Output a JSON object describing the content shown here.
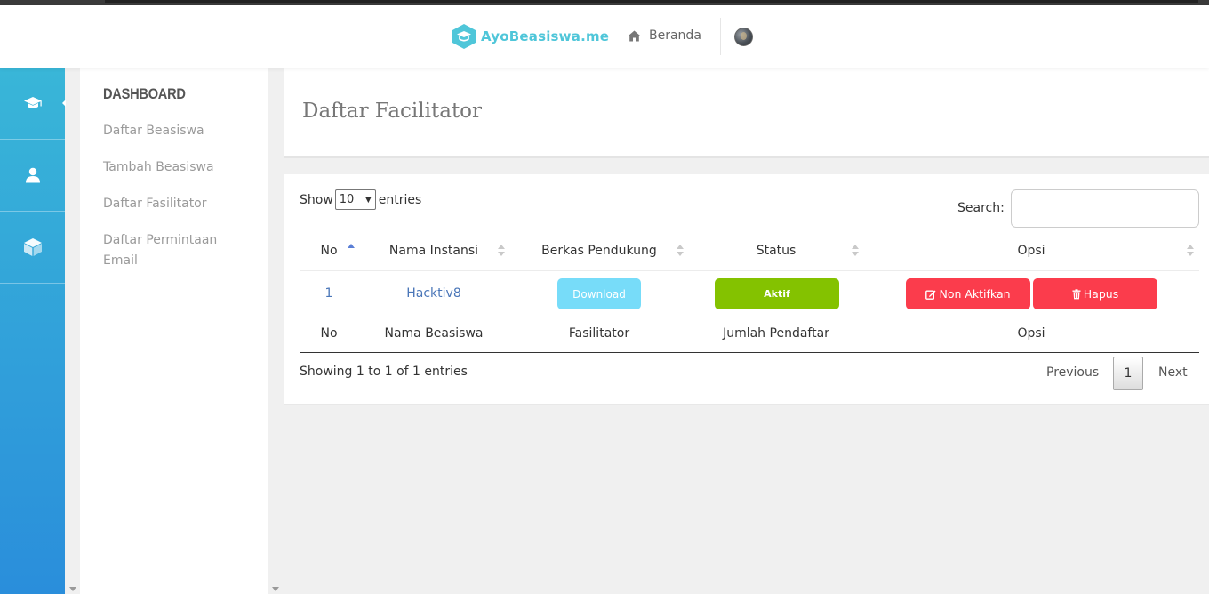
{
  "brand": {
    "name": "AyoBeasiswa.me",
    "color": "#4fc6d9"
  },
  "topnav": {
    "home_label": "Beranda",
    "home_icon": "home-icon",
    "avatar": "user-avatar"
  },
  "iconbar": {
    "items": [
      "graduation-cap-icon",
      "user-icon",
      "cube-icon"
    ],
    "gradient": [
      "#39b6d8",
      "#2a8edb"
    ]
  },
  "sidebar": {
    "title": "DASHBOARD",
    "items": [
      {
        "label": "Daftar Beasiswa"
      },
      {
        "label": "Tambah Beasiswa"
      },
      {
        "label": "Daftar Fasilitator"
      },
      {
        "label": "Daftar Permintaan Email"
      }
    ]
  },
  "page": {
    "title": "Daftar Facilitator"
  },
  "table": {
    "show_label": "Show",
    "length_value": "10",
    "entries_label": "entries",
    "search_label": "Search:",
    "search_value": "",
    "headers": [
      "No",
      "Nama Instansi",
      "Berkas Pendukung",
      "Status",
      "Opsi"
    ],
    "rows": [
      {
        "no": "1",
        "instansi": "Hacktiv8",
        "berkas": "Download",
        "status": "Aktif",
        "deactivate": "Non Aktifkan",
        "delete": "Hapus"
      }
    ],
    "footers": [
      "No",
      "Nama Beasiswa",
      "Fasilitator",
      "Jumlah Pendaftar",
      "Opsi"
    ],
    "info": "Showing 1 to 1 of 1 entries",
    "pagination": {
      "previous": "Previous",
      "current": "1",
      "next": "Next"
    }
  },
  "colors": {
    "status_active": "#84c200",
    "danger": "#fb3c4c",
    "download": "#77dcf9",
    "link": "#4a76b8"
  }
}
